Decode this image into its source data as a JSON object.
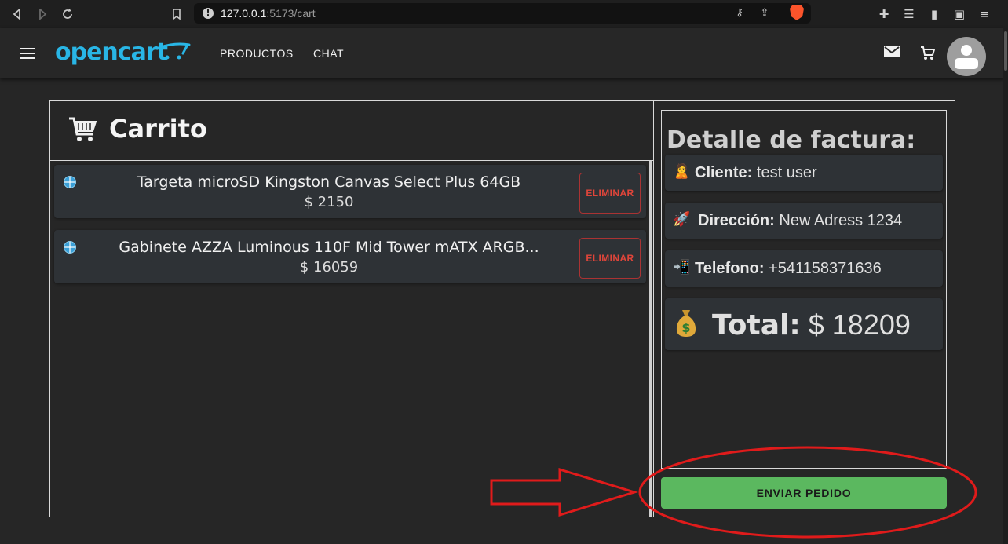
{
  "browser": {
    "url_host": "127.0.0.1",
    "url_path": ":5173/cart"
  },
  "header": {
    "logo": "opencart",
    "nav": [
      "PRODUCTOS",
      "CHAT"
    ]
  },
  "cart": {
    "title": "Carrito",
    "items": [
      {
        "name": "Targeta microSD Kingston Canvas Select Plus 64GB",
        "price": "$ 2150",
        "remove_label": "ELIMINAR"
      },
      {
        "name": "Gabinete AZZA Luminous 110F Mid Tower mATX ARGB...",
        "price": "$ 16059",
        "remove_label": "ELIMINAR"
      }
    ]
  },
  "invoice": {
    "title": "Detalle de factura:",
    "client_label": "Cliente:",
    "client_value": "test user",
    "address_label": "Dirección:",
    "address_value": "New Adress 1234",
    "phone_label": "Telefono:",
    "phone_value": "+541158371636",
    "total_label": "Total:",
    "total_value": "$ 18209",
    "emoji_client": "🙎",
    "emoji_address": "🚀",
    "emoji_phone": "📲"
  },
  "actions": {
    "send_label": "ENVIAR PEDIDO"
  },
  "colors": {
    "accent_logo": "#29b6e6",
    "send_button": "#5bb85f",
    "remove_text": "#e0453a",
    "annotation_red": "#e01b1b"
  }
}
